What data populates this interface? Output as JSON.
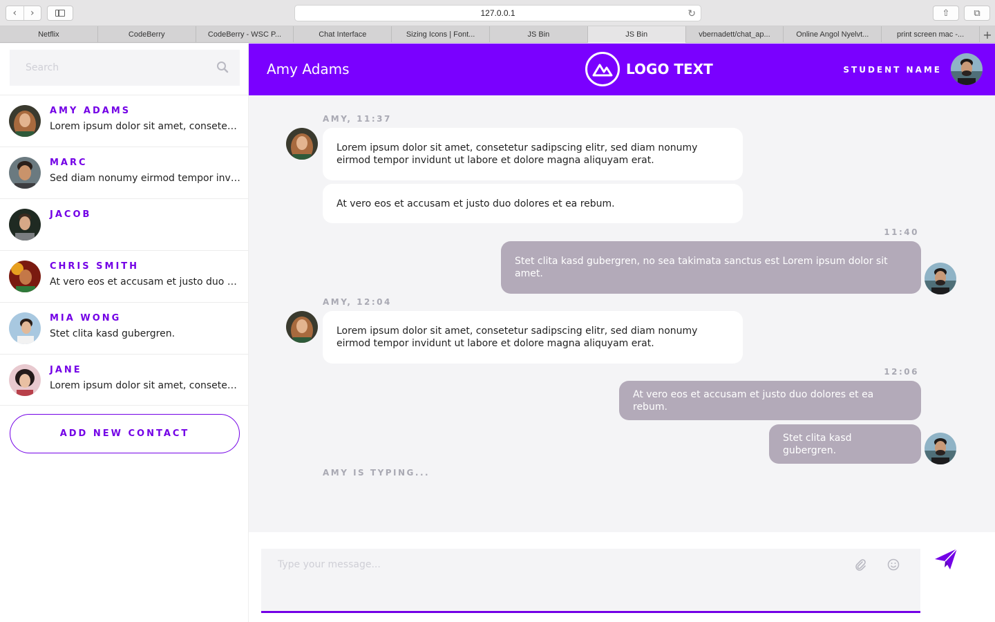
{
  "browser": {
    "url": "127.0.0.1",
    "tabs": [
      "Netflix",
      "CodeBerry",
      "CodeBerry - WSC P...",
      "Chat Interface",
      "Sizing Icons | Font...",
      "JS Bin",
      "JS Bin",
      "vbernadett/chat_ap...",
      "Online Angol Nyelvt...",
      "print screen mac -..."
    ],
    "active_tab": 6
  },
  "sidebar": {
    "search_placeholder": "Search",
    "contacts": [
      {
        "name": "AMY ADAMS",
        "preview": "Lorem ipsum dolor sit amet, consetetur sadipscing elitr"
      },
      {
        "name": "MARC",
        "preview": "Sed diam nonumy eirmod tempor invidunt"
      },
      {
        "name": "JACOB",
        "preview": ""
      },
      {
        "name": "CHRIS SMITH",
        "preview": "At vero eos et accusam et justo duo dolores"
      },
      {
        "name": "MIA WONG",
        "preview": "Stet clita kasd gubergren."
      },
      {
        "name": "JANE",
        "preview": "Lorem ipsum dolor sit amet, consetetur sadipscing elitr"
      }
    ],
    "add_contact_label": "ADD NEW CONTACT"
  },
  "header": {
    "title": "Amy Adams",
    "logo_text": "LOGO TEXT",
    "student_name": "STUDENT NAME"
  },
  "chat": {
    "meta1": "AMY, 11:37",
    "msg1": "Lorem ipsum dolor sit amet, consetetur sadipscing elitr, sed diam nonumy eirmod tempor invidunt ut labore et dolore magna aliquyam erat.",
    "msg2": "At vero eos et accusam et justo duo dolores et ea rebum.",
    "meta2": "11:40",
    "msg3": "Stet clita kasd gubergren, no sea takimata sanctus est Lorem ipsum dolor sit amet.",
    "meta3": "AMY, 12:04",
    "msg4": "Lorem ipsum dolor sit amet, consetetur sadipscing elitr, sed diam nonumy eirmod tempor invidunt ut labore et dolore magna aliquyam erat.",
    "meta4": "12:06",
    "msg5": "At vero eos et accusam et justo duo dolores et ea rebum.",
    "msg6": "Stet clita kasd gubergren.",
    "typing": "AMY IS TYPING..."
  },
  "composer": {
    "placeholder": "Type your message..."
  },
  "colors": {
    "accent": "#7300e6",
    "header": "#7a00ff",
    "sent_bubble": "#b3aab9",
    "background": "#f4f4f6"
  }
}
